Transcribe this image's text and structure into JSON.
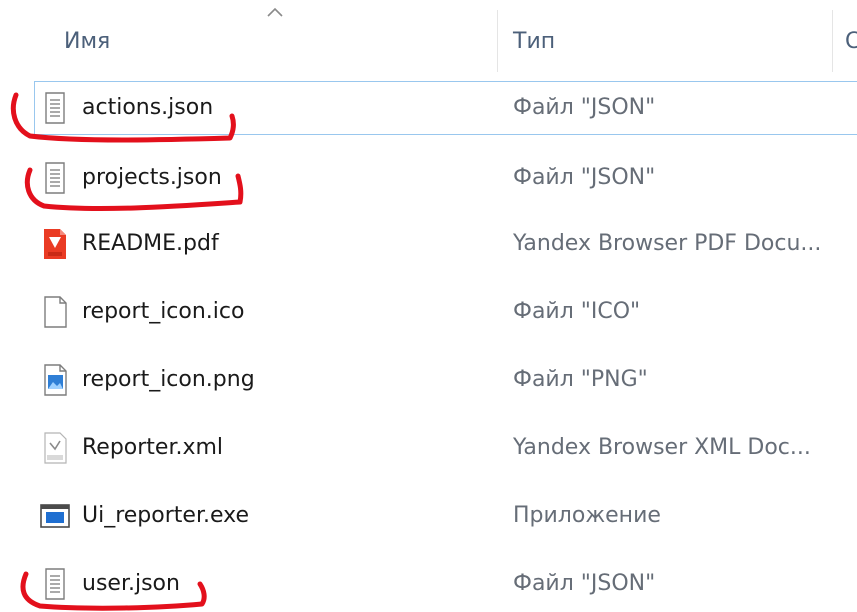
{
  "header": {
    "name_label": "Имя",
    "type_label": "Тип",
    "more_label": "С"
  },
  "files": [
    {
      "name": "actions.json",
      "type": "Файл \"JSON\"",
      "icon": "document-icon",
      "highlighted": true
    },
    {
      "name": "projects.json",
      "type": "Файл \"JSON\"",
      "icon": "document-icon",
      "highlighted": true
    },
    {
      "name": "README.pdf",
      "type": "Yandex Browser PDF Docu...",
      "icon": "pdf-icon",
      "highlighted": false
    },
    {
      "name": "report_icon.ico",
      "type": "Файл \"ICO\"",
      "icon": "blank-file-icon",
      "highlighted": false
    },
    {
      "name": "report_icon.png",
      "type": "Файл \"PNG\"",
      "icon": "image-file-icon",
      "highlighted": false
    },
    {
      "name": "Reporter.xml",
      "type": "Yandex Browser XML Doc...",
      "icon": "xml-file-icon",
      "highlighted": false
    },
    {
      "name": "Ui_reporter.exe",
      "type": "Приложение",
      "icon": "application-icon",
      "highlighted": false
    },
    {
      "name": "user.json",
      "type": "Файл \"JSON\"",
      "icon": "document-icon",
      "highlighted": true
    }
  ],
  "colors": {
    "highlight_stroke": "#e3101c",
    "focus_border": "#99c7ee",
    "header_text": "#4c607a",
    "type_text": "#666d77"
  }
}
